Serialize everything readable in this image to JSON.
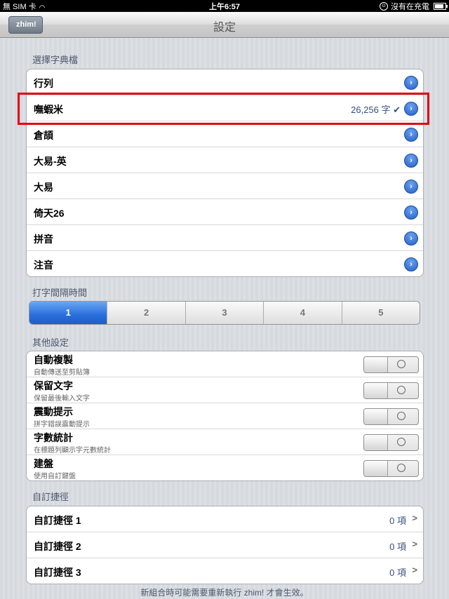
{
  "status_bar": {
    "carrier": "無 SIM 卡",
    "time": "上午6:57",
    "battery_text": "沒有在充電"
  },
  "nav": {
    "back_label": "zhim!",
    "title": "設定"
  },
  "dictionary": {
    "header": "選擇字典檔",
    "items": [
      {
        "label": "行列",
        "detail": ""
      },
      {
        "label": "嘸蝦米",
        "detail": "26,256 字 ✔"
      },
      {
        "label": "倉頡",
        "detail": ""
      },
      {
        "label": "大易-英",
        "detail": ""
      },
      {
        "label": "大易",
        "detail": ""
      },
      {
        "label": "倚天26",
        "detail": ""
      },
      {
        "label": "拼音",
        "detail": ""
      },
      {
        "label": "注音",
        "detail": ""
      }
    ],
    "disclosure_icon": "›"
  },
  "interval": {
    "header": "打字間隔時間",
    "options": [
      "1",
      "2",
      "3",
      "4",
      "5"
    ],
    "selected": "1"
  },
  "other": {
    "header": "其他設定",
    "items": [
      {
        "title": "自動複製",
        "subtitle": "自動傳送至剪貼簿"
      },
      {
        "title": "保留文字",
        "subtitle": "保留最後輸入文字"
      },
      {
        "title": "震動提示",
        "subtitle": "拼字錯誤震動提示"
      },
      {
        "title": "字數統計",
        "subtitle": "在標題列顯示字元數統計"
      },
      {
        "title": "建盤",
        "subtitle": "使用自訂鍵盤"
      }
    ]
  },
  "shortcuts": {
    "header": "自訂捷徑",
    "items": [
      {
        "label": "自訂捷徑 1",
        "value": "0 項"
      },
      {
        "label": "自訂捷徑 2",
        "value": "0 項"
      },
      {
        "label": "自訂捷徑 3",
        "value": "0 項"
      }
    ]
  },
  "footer": "新組合時可能需要重新執行 zhim! 才會生效。",
  "colors": {
    "accent": "#2a6edc",
    "highlight_box": "#e1000f"
  }
}
